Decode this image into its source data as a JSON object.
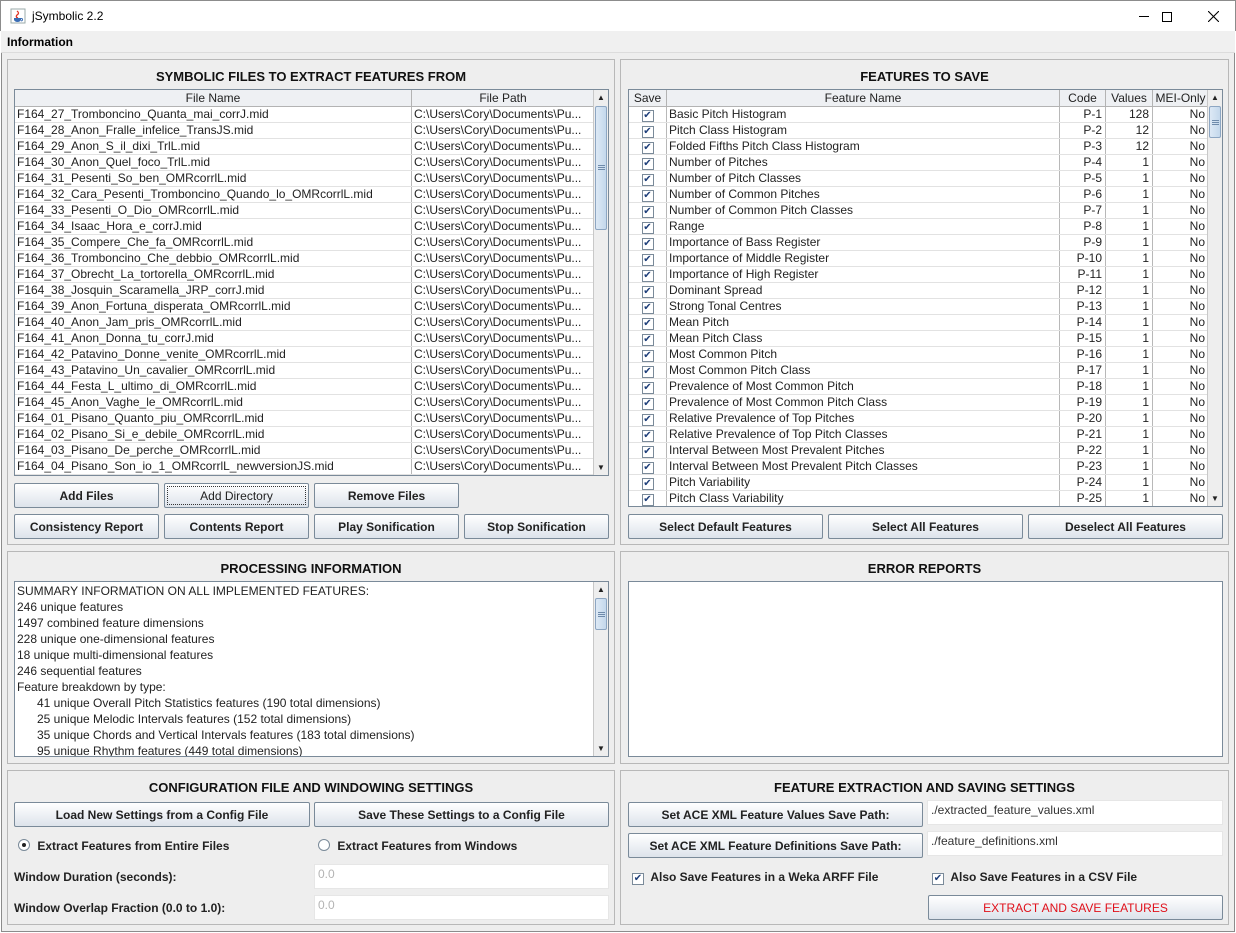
{
  "window": {
    "title": "jSymbolic 2.2",
    "minimize": "—",
    "maximize": "☐",
    "close": "✕"
  },
  "menu": {
    "information": "Information"
  },
  "symbolic_files": {
    "title": "SYMBOLIC FILES TO EXTRACT FEATURES FROM",
    "columns": [
      "File Name",
      "File Path"
    ],
    "rows": [
      [
        "F164_27_Tromboncino_Quanta_mai_corrJ.mid",
        "C:\\Users\\Cory\\Documents\\Pu..."
      ],
      [
        "F164_28_Anon_Fralle_infelice_TransJS.mid",
        "C:\\Users\\Cory\\Documents\\Pu..."
      ],
      [
        "F164_29_Anon_S_il_dixi_TrlL.mid",
        "C:\\Users\\Cory\\Documents\\Pu..."
      ],
      [
        "F164_30_Anon_Quel_foco_TrlL.mid",
        "C:\\Users\\Cory\\Documents\\Pu..."
      ],
      [
        "F164_31_Pesenti_So_ben_OMRcorrlL.mid",
        "C:\\Users\\Cory\\Documents\\Pu..."
      ],
      [
        "F164_32_Cara_Pesenti_Tromboncino_Quando_lo_OMRcorrlL.mid",
        "C:\\Users\\Cory\\Documents\\Pu..."
      ],
      [
        "F164_33_Pesenti_O_Dio_OMRcorrlL.mid",
        "C:\\Users\\Cory\\Documents\\Pu..."
      ],
      [
        "F164_34_Isaac_Hora_e_corrJ.mid",
        "C:\\Users\\Cory\\Documents\\Pu..."
      ],
      [
        "F164_35_Compere_Che_fa_OMRcorrlL.mid",
        "C:\\Users\\Cory\\Documents\\Pu..."
      ],
      [
        "F164_36_Tromboncino_Che_debbio_OMRcorrlL.mid",
        "C:\\Users\\Cory\\Documents\\Pu..."
      ],
      [
        "F164_37_Obrecht_La_tortorella_OMRcorrlL.mid",
        "C:\\Users\\Cory\\Documents\\Pu..."
      ],
      [
        "F164_38_Josquin_Scaramella_JRP_corrJ.mid",
        "C:\\Users\\Cory\\Documents\\Pu..."
      ],
      [
        "F164_39_Anon_Fortuna_disperata_OMRcorrlL.mid",
        "C:\\Users\\Cory\\Documents\\Pu..."
      ],
      [
        "F164_40_Anon_Jam_pris_OMRcorrlL.mid",
        "C:\\Users\\Cory\\Documents\\Pu..."
      ],
      [
        "F164_41_Anon_Donna_tu_corrJ.mid",
        "C:\\Users\\Cory\\Documents\\Pu..."
      ],
      [
        "F164_42_Patavino_Donne_venite_OMRcorrlL.mid",
        "C:\\Users\\Cory\\Documents\\Pu..."
      ],
      [
        "F164_43_Patavino_Un_cavalier_OMRcorrlL.mid",
        "C:\\Users\\Cory\\Documents\\Pu..."
      ],
      [
        "F164_44_Festa_L_ultimo_di_OMRcorrlL.mid",
        "C:\\Users\\Cory\\Documents\\Pu..."
      ],
      [
        "F164_45_Anon_Vaghe_le_OMRcorrlL.mid",
        "C:\\Users\\Cory\\Documents\\Pu..."
      ],
      [
        "F164_01_Pisano_Quanto_piu_OMRcorrlL.mid",
        "C:\\Users\\Cory\\Documents\\Pu..."
      ],
      [
        "F164_02_Pisano_Si_e_debile_OMRcorrlL.mid",
        "C:\\Users\\Cory\\Documents\\Pu..."
      ],
      [
        "F164_03_Pisano_De_perche_OMRcorrlL.mid",
        "C:\\Users\\Cory\\Documents\\Pu..."
      ],
      [
        "F164_04_Pisano_Son_io_1_OMRcorrlL_newversionJS.mid",
        "C:\\Users\\Cory\\Documents\\Pu..."
      ]
    ],
    "buttons": {
      "add_files": "Add Files",
      "add_directory": "Add Directory",
      "remove_files": "Remove Files",
      "consistency_report": "Consistency Report",
      "contents_report": "Contents Report",
      "play_sonification": "Play Sonification",
      "stop_sonification": "Stop Sonification"
    }
  },
  "features": {
    "title": "FEATURES TO SAVE",
    "columns": [
      "Save",
      "Feature Name",
      "Code",
      "Values",
      "MEI-Only"
    ],
    "check_glyph": "✔",
    "rows": [
      [
        "Basic Pitch Histogram",
        "P-1",
        "128",
        "No"
      ],
      [
        "Pitch Class Histogram",
        "P-2",
        "12",
        "No"
      ],
      [
        "Folded Fifths Pitch Class Histogram",
        "P-3",
        "12",
        "No"
      ],
      [
        "Number of Pitches",
        "P-4",
        "1",
        "No"
      ],
      [
        "Number of Pitch Classes",
        "P-5",
        "1",
        "No"
      ],
      [
        "Number of Common Pitches",
        "P-6",
        "1",
        "No"
      ],
      [
        "Number of Common Pitch Classes",
        "P-7",
        "1",
        "No"
      ],
      [
        "Range",
        "P-8",
        "1",
        "No"
      ],
      [
        "Importance of Bass Register",
        "P-9",
        "1",
        "No"
      ],
      [
        "Importance of Middle Register",
        "P-10",
        "1",
        "No"
      ],
      [
        "Importance of High Register",
        "P-11",
        "1",
        "No"
      ],
      [
        "Dominant Spread",
        "P-12",
        "1",
        "No"
      ],
      [
        "Strong Tonal Centres",
        "P-13",
        "1",
        "No"
      ],
      [
        "Mean Pitch",
        "P-14",
        "1",
        "No"
      ],
      [
        "Mean Pitch Class",
        "P-15",
        "1",
        "No"
      ],
      [
        "Most Common Pitch",
        "P-16",
        "1",
        "No"
      ],
      [
        "Most Common Pitch Class",
        "P-17",
        "1",
        "No"
      ],
      [
        "Prevalence of Most Common Pitch",
        "P-18",
        "1",
        "No"
      ],
      [
        "Prevalence of Most Common Pitch Class",
        "P-19",
        "1",
        "No"
      ],
      [
        "Relative Prevalence of Top Pitches",
        "P-20",
        "1",
        "No"
      ],
      [
        "Relative Prevalence of Top Pitch Classes",
        "P-21",
        "1",
        "No"
      ],
      [
        "Interval Between Most Prevalent Pitches",
        "P-22",
        "1",
        "No"
      ],
      [
        "Interval Between Most Prevalent Pitch Classes",
        "P-23",
        "1",
        "No"
      ],
      [
        "Pitch Variability",
        "P-24",
        "1",
        "No"
      ],
      [
        "Pitch Class Variability",
        "P-25",
        "1",
        "No"
      ]
    ],
    "buttons": {
      "select_default": "Select Default Features",
      "select_all": "Select All Features",
      "deselect_all": "Deselect All Features"
    }
  },
  "processing": {
    "title": "PROCESSING INFORMATION",
    "lines": [
      "SUMMARY INFORMATION ON ALL IMPLEMENTED FEATURES:",
      "246 unique features",
      "1497 combined feature dimensions",
      "228 unique one-dimensional features",
      "18 unique multi-dimensional features",
      "246 sequential features",
      "Feature breakdown by type:"
    ],
    "indented_lines": [
      "41 unique Overall Pitch Statistics features (190 total dimensions)",
      "25 unique Melodic Intervals features (152 total dimensions)",
      "35 unique Chords and Vertical Intervals features (183 total dimensions)",
      "95 unique Rhythm features (449 total dimensions)"
    ]
  },
  "errors": {
    "title": "ERROR REPORTS"
  },
  "config": {
    "title": "CONFIGURATION FILE AND WINDOWING SETTINGS",
    "load_button": "Load New Settings from a Config File",
    "save_button": "Save These Settings to a Config File",
    "radio_entire": "Extract Features from Entire Files",
    "radio_windows": "Extract Features from Windows",
    "window_duration_label": "Window Duration (seconds):",
    "window_duration_value": "0.0",
    "window_overlap_label": "Window Overlap Fraction (0.0 to 1.0):",
    "window_overlap_value": "0.0"
  },
  "extraction": {
    "title": "FEATURE EXTRACTION AND SAVING SETTINGS",
    "values_path_button": "Set ACE XML Feature Values Save Path:",
    "values_path": "./extracted_feature_values.xml",
    "definitions_path_button": "Set ACE XML Feature Definitions Save Path:",
    "definitions_path": "./feature_definitions.xml",
    "arff_checkbox": "Also Save Features in a Weka ARFF File",
    "csv_checkbox": "Also Save Features in a CSV File",
    "extract_button": "EXTRACT AND SAVE FEATURES"
  },
  "colors": {
    "accent_red": "#e0101a",
    "panel_bg": "#eeeeee"
  }
}
